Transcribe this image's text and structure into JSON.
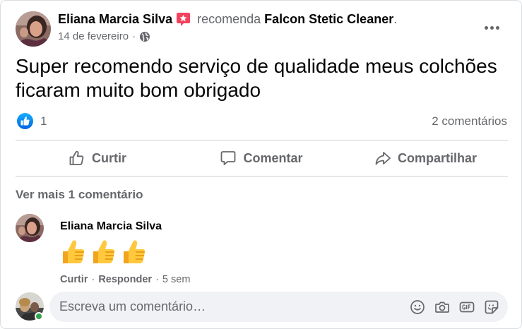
{
  "post": {
    "author": "Eliana Marcia Silva",
    "verb": "recomenda",
    "page": "Falcon Stetic Cleaner",
    "end_dot": ".",
    "date": "14 de fevereiro",
    "date_sep": "·",
    "text": "Super recomendo serviço de qualidade meus colchões ficaram muito bom obrigado"
  },
  "stats": {
    "reactions": "1",
    "comments": "2 comentários"
  },
  "actions": {
    "like": "Curtir",
    "comment": "Comentar",
    "share": "Compartilhar"
  },
  "comments": {
    "see_more": "Ver mais 1 comentário",
    "items": [
      {
        "author": "Eliana Marcia Silva",
        "emoji": "👍👍👍",
        "like": "Curtir",
        "reply": "Responder",
        "time": "5 sem",
        "sep": "·"
      }
    ]
  },
  "composer": {
    "placeholder": "Escreva um comentário…"
  },
  "icons": {
    "recommend": "recommend-star-icon",
    "privacy": "globe-icon",
    "more": "more-options-icon",
    "like_reaction": "like-reaction-icon",
    "like": "thumbs-up-icon",
    "comment": "comment-bubble-icon",
    "share": "share-arrow-icon",
    "emoji": "emoji-icon",
    "camera": "camera-icon",
    "gif": "gif-icon",
    "sticker": "sticker-icon"
  },
  "colors": {
    "brand_blue": "#1877f2",
    "recommend_pink": "#f3425f",
    "secondary_text": "#65676b",
    "online_green": "#31a24c"
  }
}
